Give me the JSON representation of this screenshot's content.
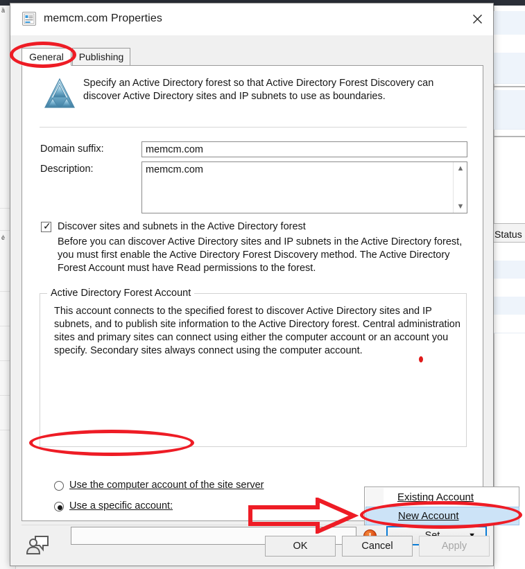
{
  "background": {
    "status_column_header": "Status"
  },
  "dialog": {
    "title": "memcm.com Properties",
    "title_icon": "properties-document-icon",
    "close_icon": "close-icon",
    "tabs": [
      {
        "label": "General",
        "selected": true
      },
      {
        "label": "Publishing",
        "selected": false
      }
    ],
    "header": {
      "icon": "active-directory-forest-icon",
      "text": "Specify an Active Directory forest so that Active Directory Forest Discovery can discover Active Directory sites and IP subnets to use as boundaries."
    },
    "fields": {
      "domain_suffix_label": "Domain suffix:",
      "domain_suffix_value": "memcm.com",
      "description_label": "Description:",
      "description_value": "memcm.com",
      "scroll_up_icon": "chevron-up-icon",
      "scroll_down_icon": "chevron-down-icon"
    },
    "discover_checkbox": {
      "checked": true,
      "check_glyph": "✓",
      "label": "Discover sites and subnets in the Active Directory forest",
      "help_text": "Before you can discover Active Directory sites and IP subnets in the Active Directory forest, you must first enable the Active Directory Forest Discovery method. The Active Directory Forest Account must have Read permissions to the forest."
    },
    "forest_account_group": {
      "title": "Active Directory Forest Account",
      "text": "This account connects to the specified forest to discover Active Directory sites and IP subnets, and to publish site information to the Active Directory forest. Central administration sites and primary sites can connect using either the computer account or an account you specify. Secondary sites always connect using the computer account."
    },
    "account_mode": {
      "options": [
        {
          "label": "Use the computer account of the site server",
          "accelerator": "U",
          "selected": false
        },
        {
          "label": "Use a specific account:",
          "accelerator": "U",
          "selected": true
        }
      ]
    },
    "account_row": {
      "input_value": "",
      "input_placeholder": "",
      "error_icon": "error-exclamation-icon",
      "error_glyph": "!",
      "set_button_label": "Set...",
      "set_button_caret": "▼"
    },
    "set_menu": {
      "items": [
        {
          "label": "Existing Account",
          "accelerator": "E",
          "highlighted": false
        },
        {
          "label": "New Account",
          "accelerator": "N",
          "highlighted": true
        }
      ]
    },
    "footer": {
      "feedback_icon": "send-feedback-icon",
      "ok_label": "OK",
      "cancel_label": "Cancel",
      "apply_label": "Apply",
      "apply_enabled": false
    }
  },
  "annotations": {
    "accent_color": "#ee1c25",
    "marks": [
      {
        "shape": "ellipse",
        "target": "general-tab"
      },
      {
        "shape": "ellipse",
        "target": "use-a-specific-account-radio"
      },
      {
        "shape": "ellipse",
        "target": "new-account-menu-item"
      },
      {
        "shape": "arrow",
        "direction": "right",
        "target": "new-account-menu-item"
      },
      {
        "shape": "dot",
        "target": "forest-account-group-text"
      }
    ]
  }
}
